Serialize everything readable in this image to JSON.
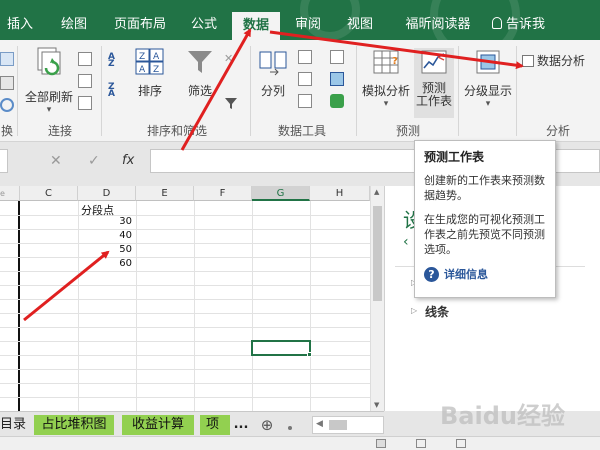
{
  "tabs": [
    {
      "label": "插入",
      "active": false
    },
    {
      "label": "绘图",
      "active": false
    },
    {
      "label": "页面布局",
      "active": false
    },
    {
      "label": "公式",
      "active": false
    },
    {
      "label": "数据",
      "active": true
    },
    {
      "label": "审阅",
      "active": false
    },
    {
      "label": "视图",
      "active": false
    },
    {
      "label": "福昕阅读器",
      "active": false
    }
  ],
  "tell_me": "告诉我",
  "ribbon": {
    "refresh_all": "全部刷新",
    "sort": "排序",
    "filter": "筛选",
    "split": "分列",
    "whatif": "模拟分析",
    "forecast_sheet": "预测\n工作表",
    "outline": "分级显示",
    "data_analysis": "数据分析",
    "groups": {
      "connections": "连接",
      "sort_filter": "排序和筛选",
      "data_tools": "数据工具",
      "forecast": "预测",
      "analysis": "分析"
    },
    "left_partial_label": "换"
  },
  "formula_bar": {
    "fx": "fx",
    "cancel": "✕",
    "enter": "✓",
    "value": ""
  },
  "grid": {
    "columns": [
      "C",
      "D",
      "E",
      "F",
      "G",
      "H"
    ],
    "selected_column": "G",
    "header_cell": "分段点",
    "values": [
      "30",
      "40",
      "50",
      "60"
    ],
    "partial_left_header": "e"
  },
  "tooltip": {
    "title": "预测工作表",
    "p1": "创建新的工作表来预测数据趋势。",
    "p2": "在生成您的可视化预测工作表之前先预览不同预测选项。",
    "more": "详细信息"
  },
  "pane": {
    "title_partial": "设",
    "item": "线条"
  },
  "sheets": [
    {
      "label": "目录",
      "green": false
    },
    {
      "label": "占比堆积图",
      "green": true
    },
    {
      "label": "收益计算",
      "green": true
    },
    {
      "label": "项目",
      "green": true
    }
  ],
  "sheet_more": "...",
  "watermark": "Baidu经验",
  "colors": {
    "excel_green": "#217346",
    "sheet_green": "#92d050",
    "arrow_red": "#e02020",
    "link_blue": "#2b579a"
  }
}
